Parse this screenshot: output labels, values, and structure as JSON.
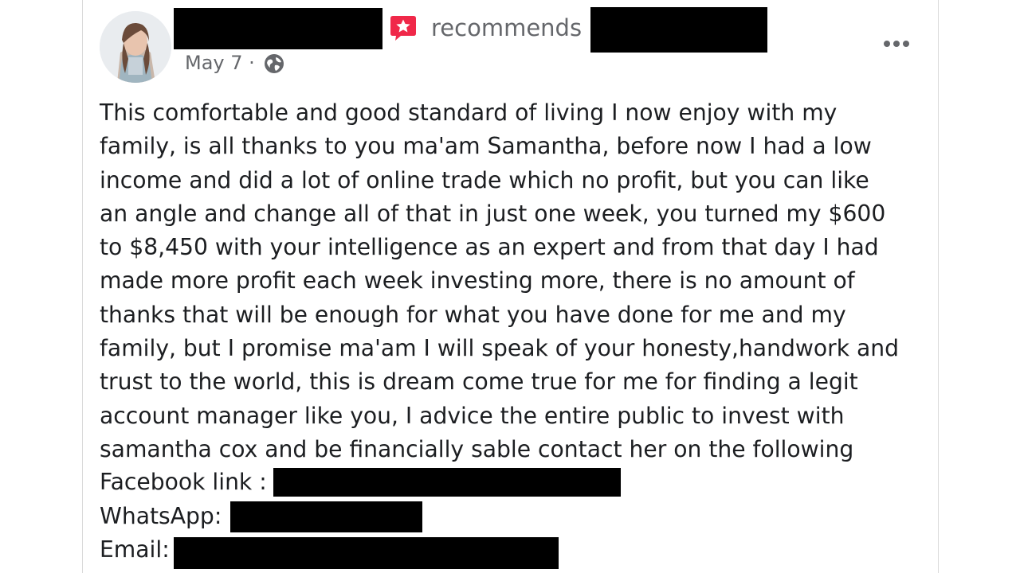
{
  "post": {
    "action_text": "recommends",
    "date_text": "May 7 ·",
    "privacy_icon": "globe-icon",
    "recommend_icon": "recommend-star-icon",
    "menu_icon": "more-options-icon",
    "body_lines": [
      "This comfortable and good standard of living I now enjoy with my",
      "family, is all thanks to you ma'am Samantha, before now I had a low",
      "income and did a lot of online trade which no profit, but you can like",
      "an angle and change all of that in just one week, you turned my $600",
      "to $8,450 with your intelligence as an expert and from that day I had",
      "made more profit each week investing more, there is no amount of",
      "thanks that will be enough for what you have done for me and my",
      "family, but I promise ma'am I will speak of your honesty,handwork and",
      "trust to the world, this is dream come true for me for finding a legit",
      "account manager like you, I advice the entire public to invest with",
      "samantha cox and be financially sable contact her on the following"
    ],
    "contacts": {
      "facebook_label": "Facebook link :",
      "whatsapp_label": "WhatsApp:",
      "email_label": "Email:"
    }
  },
  "colors": {
    "recommend_accent": "#f02849",
    "secondary_text": "#65676b",
    "primary_text": "#1c1e21",
    "redaction": "#000000"
  }
}
